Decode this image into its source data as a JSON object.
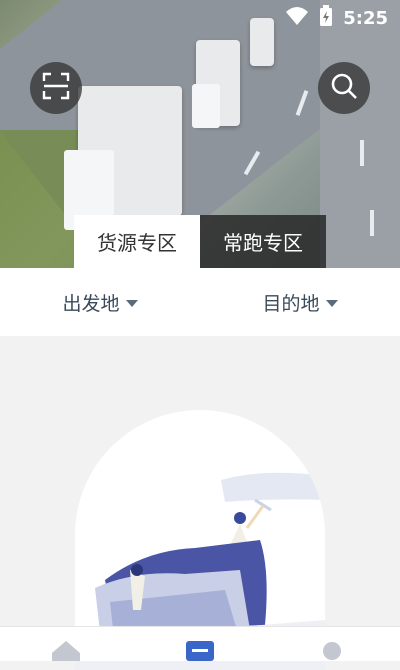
{
  "status": {
    "time": "5:25",
    "wifi_icon": "wifi-icon",
    "battery_icon": "battery-charging-icon"
  },
  "header": {
    "scan_icon": "scan-icon",
    "search_icon": "search-icon"
  },
  "tabs": [
    {
      "label": "货源专区",
      "active": true
    },
    {
      "label": "常跑专区",
      "active": false
    }
  ],
  "filters": [
    {
      "label": "出发地"
    },
    {
      "label": "目的地"
    }
  ],
  "bottom_nav": [
    {
      "icon": "home-icon",
      "active": false
    },
    {
      "icon": "list-icon",
      "active": true
    },
    {
      "icon": "profile-icon",
      "active": false
    }
  ],
  "colors": {
    "accent": "#3b66c9",
    "filter_text": "#3a4a5a"
  }
}
